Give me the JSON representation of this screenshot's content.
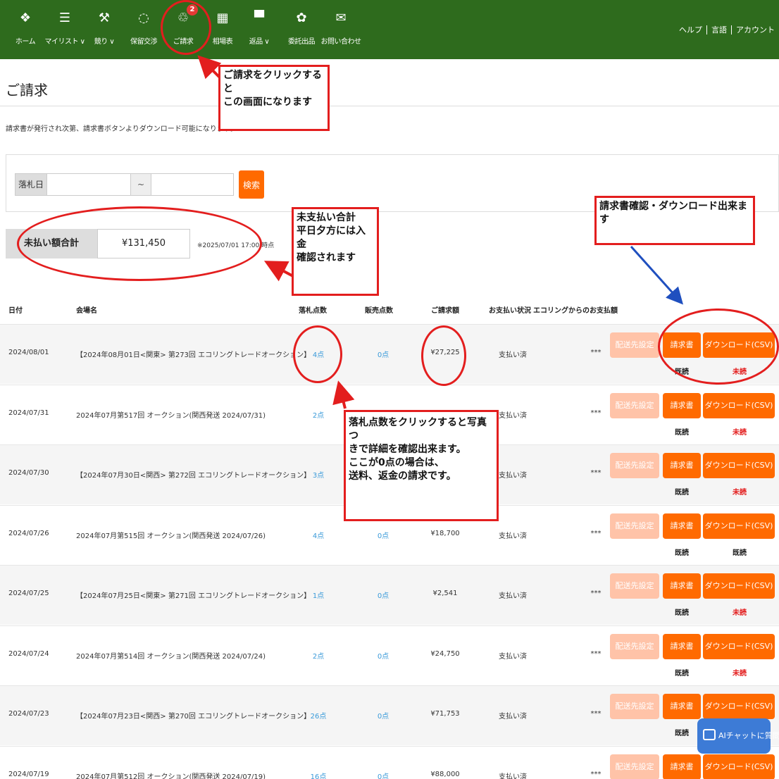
{
  "nav": {
    "items": [
      {
        "label": "ホーム",
        "icon": "home-icon",
        "glyph": "❖"
      },
      {
        "label": "マイリスト ∨",
        "icon": "list-icon",
        "glyph": "☰"
      },
      {
        "label": "競り ∨",
        "icon": "gavel-icon",
        "glyph": "⚒"
      },
      {
        "label": "保留交渉",
        "icon": "chat-bubble-icon",
        "glyph": "◌"
      },
      {
        "label": "ご請求",
        "icon": "invoice-icon",
        "glyph": "♲",
        "badge": "2"
      },
      {
        "label": "相場表",
        "icon": "grid-icon",
        "glyph": "▦"
      },
      {
        "label": "返品 ∨",
        "icon": "return-icon",
        "glyph": "▀"
      },
      {
        "label": "委託出品",
        "icon": "consign-icon",
        "glyph": "✿"
      },
      {
        "label": "お問い合わせ",
        "icon": "mail-icon",
        "glyph": "✉"
      }
    ],
    "right": [
      "ヘルプ",
      "言語",
      "アカウント"
    ]
  },
  "page": {
    "title": "ご請求",
    "notice": "請求書が発行され次第、請求書ボタンよりダウンロード可能になります。"
  },
  "search": {
    "date_label": "落札日",
    "separator": "~",
    "button": "検索"
  },
  "unpaid": {
    "label": "未払い額合計",
    "value": "¥131,450",
    "note": "※2025/07/01 17:00 時点"
  },
  "table": {
    "headers": [
      "日付",
      "会場名",
      "落札点数",
      "販売点数",
      "ご請求額",
      "お支払い状況",
      "エコリングからのお支払額"
    ],
    "buttons": {
      "ship": "配送先設定",
      "invoice": "請求書",
      "csv": "ダウンロード(CSV)"
    },
    "rows": [
      {
        "date": "2024/08/01",
        "venue": "【2024年08月01日<関東> 第273回 エコリングトレードオークション】",
        "won": "4点",
        "sold": "0点",
        "amount": "¥27,225",
        "status": "支払い済",
        "payout": "***",
        "inv_mark": "既読",
        "csv_mark": "未読"
      },
      {
        "date": "2024/07/31",
        "venue": "2024年07月第517回 オークション(関西発送 2024/07/31)",
        "won": "2点",
        "sold": "",
        "amount": "",
        "status": "支払い済",
        "payout": "***",
        "inv_mark": "既読",
        "csv_mark": "未読"
      },
      {
        "date": "2024/07/30",
        "venue": "【2024年07月30日<関西> 第272回 エコリングトレードオークション】",
        "won": "3点",
        "sold": "",
        "amount": "",
        "status": "支払い済",
        "payout": "***",
        "inv_mark": "既読",
        "csv_mark": "未読"
      },
      {
        "date": "2024/07/26",
        "venue": "2024年07月第515回 オークション(関西発送 2024/07/26)",
        "won": "4点",
        "sold": "0点",
        "amount": "¥18,700",
        "status": "支払い済",
        "payout": "***",
        "inv_mark": "既読",
        "csv_mark": "既読"
      },
      {
        "date": "2024/07/25",
        "venue": "【2024年07月25日<関東> 第271回 エコリングトレードオークション】",
        "won": "1点",
        "sold": "0点",
        "amount": "¥2,541",
        "status": "支払い済",
        "payout": "***",
        "inv_mark": "既読",
        "csv_mark": "未読"
      },
      {
        "date": "2024/07/24",
        "venue": "2024年07月第514回 オークション(関西発送 2024/07/24)",
        "won": "2点",
        "sold": "0点",
        "amount": "¥24,750",
        "status": "支払い済",
        "payout": "***",
        "inv_mark": "既読",
        "csv_mark": "未読"
      },
      {
        "date": "2024/07/23",
        "venue": "【2024年07月23日<関西> 第270回 エコリングトレードオークション】",
        "won": "26点",
        "sold": "0点",
        "amount": "¥71,753",
        "status": "支払い済",
        "payout": "***",
        "inv_mark": "既読",
        "csv_mark": ""
      },
      {
        "date": "2024/07/19",
        "venue": "2024年07月第512回 オークション(関西発送 2024/07/19)",
        "won": "16点",
        "sold": "0点",
        "amount": "¥88,000",
        "status": "支払い済",
        "payout": "***",
        "inv_mark": "",
        "csv_mark": ""
      }
    ]
  },
  "annotations": {
    "nav": [
      "ご請求をクリックすると",
      "この画面になります"
    ],
    "unpaid": [
      "未支払い合計",
      "平日夕方には入金",
      "確認されます"
    ],
    "download": [
      "請求書確認・ダウンロード出来ます"
    ],
    "won": [
      "落札点数をクリックすると写真つ",
      "きで詳細を確認出来ます。",
      "ここが0点の場合は、",
      "送料、返金の請求です。"
    ]
  },
  "chat": {
    "label": "AIチャットに質問"
  },
  "colors": {
    "nav_bg": "#2e6b1d",
    "accent": "#ff6a00",
    "annotation": "#e31e1e",
    "link": "#3a9ad9"
  }
}
